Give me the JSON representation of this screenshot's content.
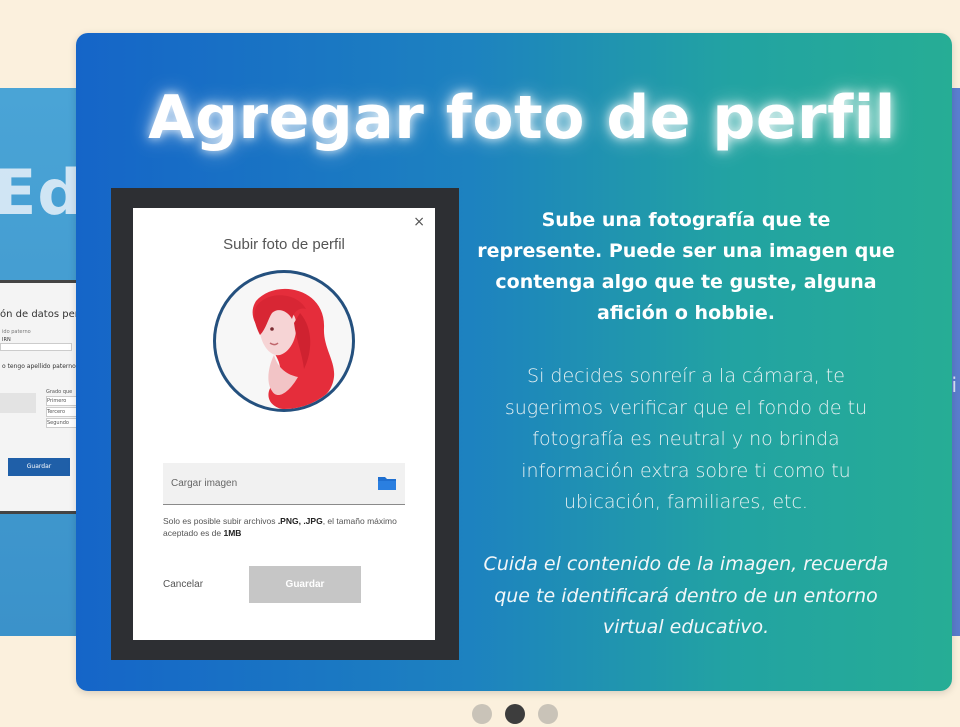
{
  "left_slide": {
    "heading_fragment": "Edit",
    "form_title_fragment": "ón de datos perso",
    "field_label": "ido paterno",
    "field_value": "IRN",
    "checkbox_label": "o tengo apellido paterno",
    "select_label": "Grado que",
    "select_options": [
      "Primero",
      "Tercero",
      "Segundo"
    ],
    "button_label": "Guardar"
  },
  "right_slide": {
    "fragment": "li"
  },
  "card": {
    "title": "Agregar foto de perfil",
    "modal": {
      "title": "Subir foto de perfil",
      "close_glyph": "×",
      "upload_placeholder": "Cargar imagen",
      "hint_prefix": "Solo es posible subir archivos ",
      "hint_formats": ".PNG, .JPG",
      "hint_middle": ", el tamaño máximo aceptado es de ",
      "hint_size": "1MB",
      "cancel_label": "Cancelar",
      "save_label": "Guardar",
      "icons": [
        "close-icon",
        "folder-icon",
        "avatar-illustration"
      ]
    },
    "paragraph_1": "Sube una fotografía que te represente. Puede ser una imagen que contenga algo que te guste, alguna afición o hobbie.",
    "paragraph_2": "Si decides sonreír a la cámara, te sugerimos verificar que el fondo de tu fotografía es neutral y no brinda información extra sobre ti como tu ubicación, familiares, etc.",
    "paragraph_3": "Cuida el contenido de la imagen, recuerda que te identificará dentro de un entorno virtual educativo."
  },
  "carousel": {
    "slide_count": 3,
    "active_index": 1
  },
  "colors": {
    "page_bg": "#fbf0dd",
    "card_gradient_start": "#1565c8",
    "card_gradient_end": "#26ad95",
    "avatar_hair": "#e52d3b",
    "avatar_border": "#24507e",
    "folder_icon": "#1f6fd0"
  }
}
